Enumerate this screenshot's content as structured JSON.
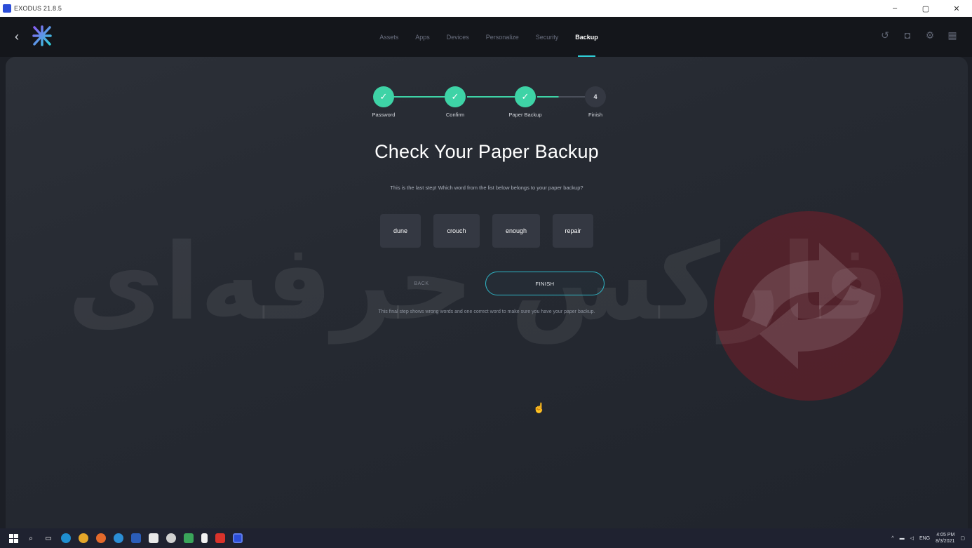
{
  "window": {
    "title": "EXODUS 21.8.5",
    "minimize_glyph": "–",
    "restore_glyph": "▢",
    "close_glyph": "✕"
  },
  "header": {
    "back_glyph": "‹",
    "nav": [
      {
        "label": "Assets",
        "active": false
      },
      {
        "label": "Apps",
        "active": false
      },
      {
        "label": "Devices",
        "active": false
      },
      {
        "label": "Personalize",
        "active": false
      },
      {
        "label": "Security",
        "active": false
      },
      {
        "label": "Backup",
        "active": true
      }
    ],
    "icons": [
      "history-icon",
      "chip-icon",
      "settings-icon",
      "grid-icon"
    ],
    "icon_glyphs": [
      "↺",
      "◘",
      "⚙",
      "▦"
    ]
  },
  "stepper": {
    "steps": [
      {
        "label": "Password",
        "done": true,
        "glyph": "✓"
      },
      {
        "label": "Confirm",
        "done": true,
        "glyph": "✓"
      },
      {
        "label": "Paper Backup",
        "done": true,
        "glyph": "✓"
      },
      {
        "label": "Finish",
        "done": false,
        "glyph": "4"
      }
    ]
  },
  "main": {
    "heading": "Check Your Paper Backup",
    "subtext": "This is the last step! Which word from the list below belongs to your paper backup?",
    "words": [
      "dune",
      "crouch",
      "enough",
      "repair"
    ],
    "back_label": "BACK",
    "finish_label": "FINISH",
    "note": "This final step shows wrong words and one correct word to make sure you have your paper backup."
  },
  "watermark": {
    "text": "فارکس حرفه‌ای"
  },
  "taskbar": {
    "tray": {
      "language": "ENG",
      "time": "4:05 PM",
      "date": "8/3/2021"
    }
  },
  "colors": {
    "accent": "#3ed3a6",
    "finish_border": "#2fb8c8",
    "nav_active_underline": "#2fd0d9",
    "watermark_red": "#781e28"
  }
}
